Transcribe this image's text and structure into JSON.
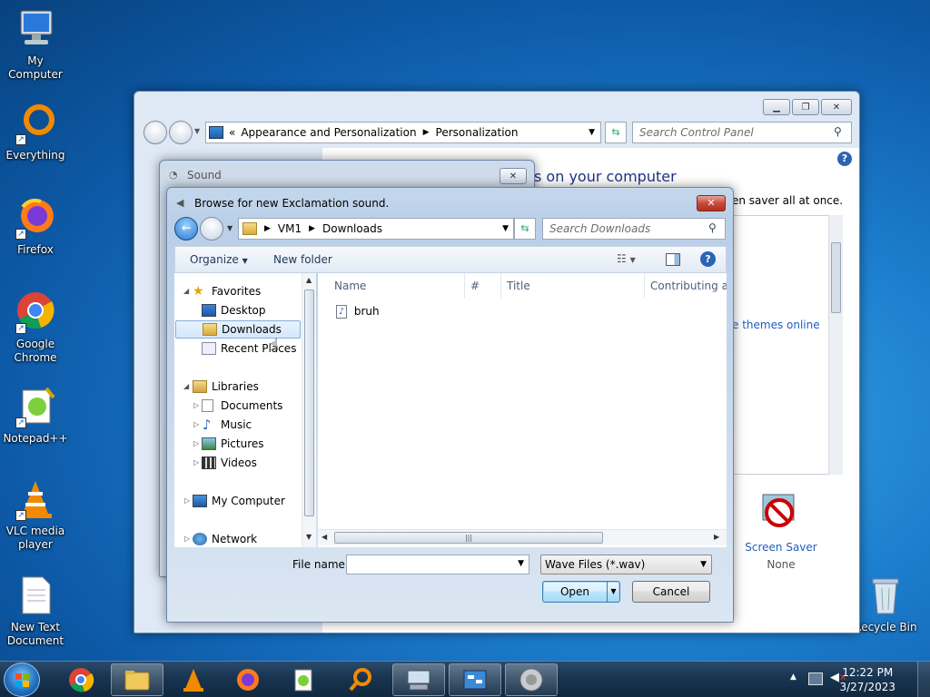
{
  "desktop": {
    "icons": [
      {
        "label": "My Computer"
      },
      {
        "label": "Everything"
      },
      {
        "label": "Firefox"
      },
      {
        "label": "Google Chrome"
      },
      {
        "label": "Notepad++"
      },
      {
        "label": "VLC media player"
      },
      {
        "label": "New Text Document"
      },
      {
        "label": "Recycle Bin"
      }
    ]
  },
  "control_panel": {
    "breadcrumb": [
      "Appearance and Personalization",
      "Personalization"
    ],
    "search_placeholder": "Search Control Panel",
    "heading_fragment": "s on your computer",
    "line_fragment": "en saver all at once.",
    "themes_link": "e themes online",
    "screen_saver_label": "Screen Saver",
    "screen_saver_value": "None"
  },
  "sound_dialog": {
    "title": "Sound"
  },
  "browse_dialog": {
    "title": "Browse for new Exclamation sound.",
    "breadcrumb": [
      "VM1",
      "Downloads"
    ],
    "search_placeholder": "Search Downloads",
    "toolbar": {
      "organize": "Organize",
      "new_folder": "New folder"
    },
    "nav": {
      "favorites": "Favorites",
      "desktop": "Desktop",
      "downloads": "Downloads",
      "recent": "Recent Places",
      "libraries": "Libraries",
      "documents": "Documents",
      "music": "Music",
      "pictures": "Pictures",
      "videos": "Videos",
      "my_computer": "My Computer",
      "network": "Network"
    },
    "columns": [
      "Name",
      "#",
      "Title",
      "Contributing ar"
    ],
    "files": [
      {
        "name": "bruh"
      }
    ],
    "file_name_label": "File name:",
    "file_name_value": "",
    "file_type": "Wave Files (*.wav)",
    "open_label": "Open",
    "cancel_label": "Cancel"
  },
  "taskbar": {
    "time": "12:22 PM",
    "date": "3/27/2023"
  }
}
